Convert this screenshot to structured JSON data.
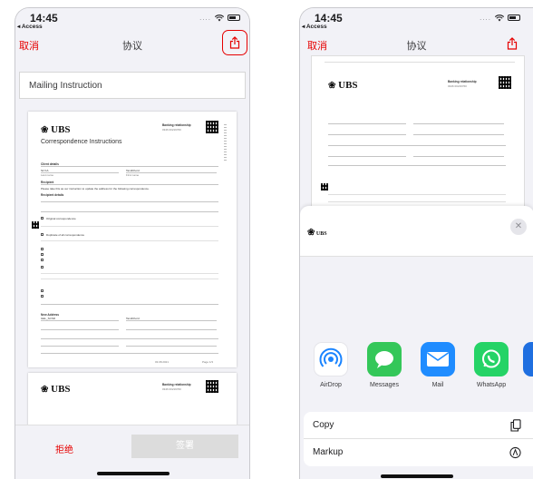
{
  "status_bar": {
    "time": "14:45",
    "back_label": "◂ Access",
    "signal_dots": "...."
  },
  "nav": {
    "cancel_label": "取消",
    "title": "协议"
  },
  "document": {
    "title_field": "Mailing Instruction",
    "logo_text": "UBS",
    "form_title": "Correspondence Instructions",
    "relationship_label": "Banking relationship",
    "relationship_no": "0346 00219760",
    "client_details": "Client details",
    "mr_name": "Sir KA",
    "last_name_label": "Last name",
    "first_name_label": "First name",
    "first_name_value": "TandChord",
    "recipient": "Recipient",
    "instruction": "Please take this as our instruction to update the address for the following correspondence.",
    "recipient_details": "Recipient details",
    "original_corr": "Original correspondence",
    "duplicate_corr": "Duplicate of all correspondence",
    "new_address": "New Address",
    "new_last_name": "GEL_SCSD",
    "new_first_name": "TandChord",
    "date": "03.08.2021",
    "page_no": "Page 1/3"
  },
  "footer": {
    "reject_label": "拒绝",
    "sign_label": "签署"
  },
  "share_sheet": {
    "close_symbol": "✕",
    "apps": [
      {
        "label": "AirDrop",
        "icon": "airdrop-icon",
        "color": "#1a84ff"
      },
      {
        "label": "Messages",
        "icon": "messages-icon",
        "color": "#34c759"
      },
      {
        "label": "Mail",
        "icon": "mail-icon",
        "color": "#1f8cff"
      },
      {
        "label": "WhatsApp",
        "icon": "whatsapp-icon",
        "color": "#25d366"
      }
    ],
    "actions": [
      {
        "label": "Copy",
        "icon": "copy-icon"
      },
      {
        "label": "Markup",
        "icon": "markup-icon"
      }
    ]
  },
  "colors": {
    "accent": "#e60000",
    "sign_disabled": "#dcdcdc"
  }
}
